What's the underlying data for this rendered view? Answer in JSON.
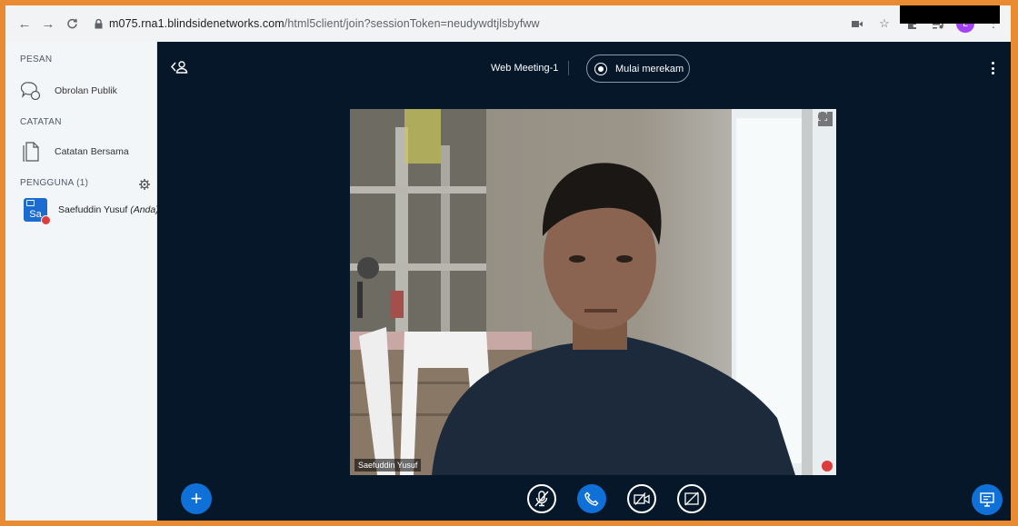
{
  "browser": {
    "url_host": "m075.rna1.blindsidenetworks.com",
    "url_path": "/html5client/join?sessionToken=neudywdtjlsbyfww",
    "profile_initial": "L"
  },
  "sidebar": {
    "messages_title": "PESAN",
    "public_chat_label": "Obrolan Publik",
    "notes_title": "CATATAN",
    "shared_notes_label": "Catatan Bersama",
    "users_title": "PENGGUNA (1)",
    "user": {
      "avatar_initials": "Sa",
      "name": "Saefuddin Yusuf",
      "self_tag": "(Anda)"
    }
  },
  "meeting": {
    "title": "Web Meeting-1",
    "record_label": "Mulai merekam",
    "video_name_label": "Saefuddin Yusuf"
  },
  "colors": {
    "frame": "#e98b33",
    "meeting_bg": "#06172a",
    "accent_blue": "#0f70d7",
    "mute_red": "#de3b3b"
  }
}
